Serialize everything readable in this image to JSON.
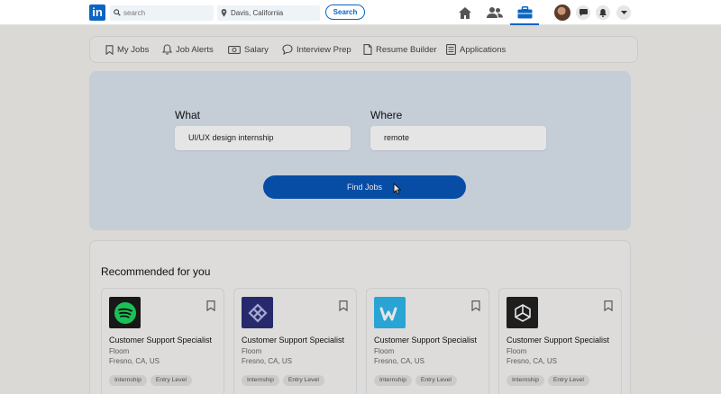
{
  "header": {
    "logo_text": "in",
    "search_placeholder": "search",
    "location_value": "Davis, California",
    "search_button": "Search"
  },
  "subnav": {
    "items": [
      {
        "label": "My Jobs",
        "icon": "bookmark-icon"
      },
      {
        "label": "Job Alerts",
        "icon": "bell-icon"
      },
      {
        "label": "Salary",
        "icon": "money-icon"
      },
      {
        "label": "Interview Prep",
        "icon": "chat-icon"
      },
      {
        "label": "Resume Builder",
        "icon": "document-icon"
      },
      {
        "label": "Applications",
        "icon": "list-icon"
      }
    ]
  },
  "search_panel": {
    "what_label": "What",
    "what_value": "UI/UX design internship",
    "where_label": "Where",
    "where_value": "remote",
    "find_button": "Find Jobs"
  },
  "recommended": {
    "title": "Recommended for you",
    "cards": [
      {
        "title": "Customer Support Specialist",
        "company": "Floom",
        "location": "Fresno, CA, US",
        "tags": [
          "Internship",
          "Entry Level"
        ],
        "logo": "spotify-logo",
        "logo_color": "#1b1b1b"
      },
      {
        "title": "Customer Support Specialist",
        "company": "Floom",
        "location": "Fresno, CA, US",
        "tags": [
          "Internship",
          "Entry Level"
        ],
        "logo": "pattern-logo",
        "logo_color": "#2b2f7a"
      },
      {
        "title": "Customer Support Specialist",
        "company": "Floom",
        "location": "Fresno, CA, US",
        "tags": [
          "Internship",
          "Entry Level"
        ],
        "logo": "wish-logo",
        "logo_color": "#2fb7ec"
      },
      {
        "title": "Customer Support Specialist",
        "company": "Floom",
        "location": "Fresno, CA, US",
        "tags": [
          "Internship",
          "Entry Level"
        ],
        "logo": "unity-logo",
        "logo_color": "#222222"
      }
    ]
  },
  "colors": {
    "brand": "#0a66c2",
    "button": "#0a56b8",
    "hero_bg": "#dce5f0"
  }
}
